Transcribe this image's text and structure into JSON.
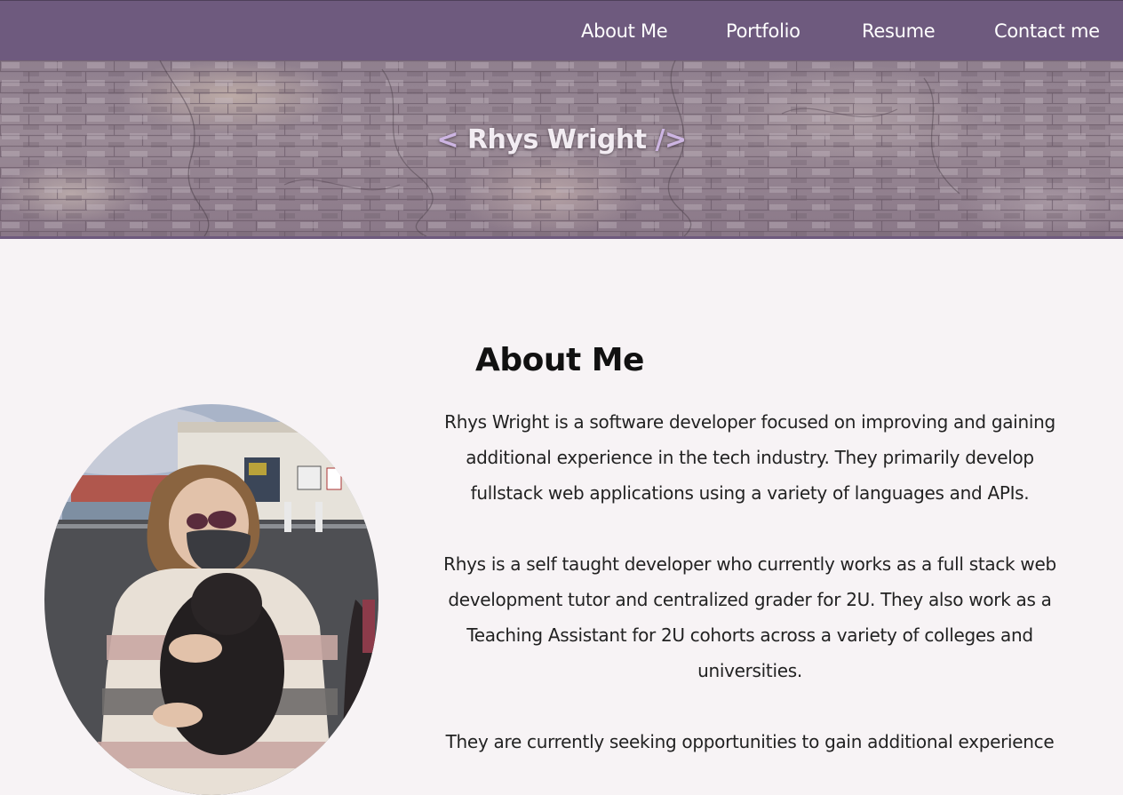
{
  "nav": {
    "items": [
      "About Me",
      "Portfolio",
      "Resume",
      "Contact me"
    ]
  },
  "hero": {
    "open_bracket": "<",
    "name": "Rhys Wright",
    "close_bracket": "/>"
  },
  "about": {
    "heading": "About Me",
    "paragraphs": [
      "Rhys Wright is a software developer focused on improving and gaining additional experience in the tech industry. They primarily develop fullstack web applications using a variety of languages and APIs.",
      "Rhys is a self taught developer who currently works as a full stack web development tutor and centralized grader for 2U. They also work as a Teaching Assistant for 2U cohorts across a variety of colleges and universities.",
      "They are currently seeking opportunities to gain additional experience"
    ]
  },
  "colors": {
    "navbar": "#6e5a7e",
    "accent_bracket": "#cdb5e2",
    "page_background": "#f7f3f5"
  }
}
